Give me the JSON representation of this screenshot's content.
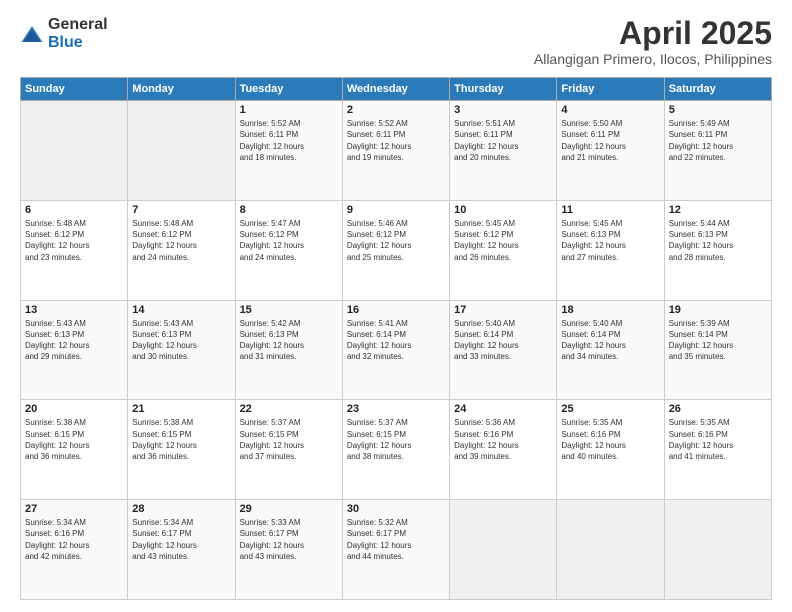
{
  "header": {
    "logo": {
      "general": "General",
      "blue": "Blue"
    },
    "title": "April 2025",
    "location": "Allangigan Primero, Ilocos, Philippines"
  },
  "weekdays": [
    "Sunday",
    "Monday",
    "Tuesday",
    "Wednesday",
    "Thursday",
    "Friday",
    "Saturday"
  ],
  "weeks": [
    [
      {
        "day": "",
        "info": ""
      },
      {
        "day": "",
        "info": ""
      },
      {
        "day": "1",
        "info": "Sunrise: 5:52 AM\nSunset: 6:11 PM\nDaylight: 12 hours\nand 18 minutes."
      },
      {
        "day": "2",
        "info": "Sunrise: 5:52 AM\nSunset: 6:11 PM\nDaylight: 12 hours\nand 19 minutes."
      },
      {
        "day": "3",
        "info": "Sunrise: 5:51 AM\nSunset: 6:11 PM\nDaylight: 12 hours\nand 20 minutes."
      },
      {
        "day": "4",
        "info": "Sunrise: 5:50 AM\nSunset: 6:11 PM\nDaylight: 12 hours\nand 21 minutes."
      },
      {
        "day": "5",
        "info": "Sunrise: 5:49 AM\nSunset: 6:11 PM\nDaylight: 12 hours\nand 22 minutes."
      }
    ],
    [
      {
        "day": "6",
        "info": "Sunrise: 5:48 AM\nSunset: 6:12 PM\nDaylight: 12 hours\nand 23 minutes."
      },
      {
        "day": "7",
        "info": "Sunrise: 5:48 AM\nSunset: 6:12 PM\nDaylight: 12 hours\nand 24 minutes."
      },
      {
        "day": "8",
        "info": "Sunrise: 5:47 AM\nSunset: 6:12 PM\nDaylight: 12 hours\nand 24 minutes."
      },
      {
        "day": "9",
        "info": "Sunrise: 5:46 AM\nSunset: 6:12 PM\nDaylight: 12 hours\nand 25 minutes."
      },
      {
        "day": "10",
        "info": "Sunrise: 5:45 AM\nSunset: 6:12 PM\nDaylight: 12 hours\nand 26 minutes."
      },
      {
        "day": "11",
        "info": "Sunrise: 5:45 AM\nSunset: 6:13 PM\nDaylight: 12 hours\nand 27 minutes."
      },
      {
        "day": "12",
        "info": "Sunrise: 5:44 AM\nSunset: 6:13 PM\nDaylight: 12 hours\nand 28 minutes."
      }
    ],
    [
      {
        "day": "13",
        "info": "Sunrise: 5:43 AM\nSunset: 6:13 PM\nDaylight: 12 hours\nand 29 minutes."
      },
      {
        "day": "14",
        "info": "Sunrise: 5:43 AM\nSunset: 6:13 PM\nDaylight: 12 hours\nand 30 minutes."
      },
      {
        "day": "15",
        "info": "Sunrise: 5:42 AM\nSunset: 6:13 PM\nDaylight: 12 hours\nand 31 minutes."
      },
      {
        "day": "16",
        "info": "Sunrise: 5:41 AM\nSunset: 6:14 PM\nDaylight: 12 hours\nand 32 minutes."
      },
      {
        "day": "17",
        "info": "Sunrise: 5:40 AM\nSunset: 6:14 PM\nDaylight: 12 hours\nand 33 minutes."
      },
      {
        "day": "18",
        "info": "Sunrise: 5:40 AM\nSunset: 6:14 PM\nDaylight: 12 hours\nand 34 minutes."
      },
      {
        "day": "19",
        "info": "Sunrise: 5:39 AM\nSunset: 6:14 PM\nDaylight: 12 hours\nand 35 minutes."
      }
    ],
    [
      {
        "day": "20",
        "info": "Sunrise: 5:38 AM\nSunset: 6:15 PM\nDaylight: 12 hours\nand 36 minutes."
      },
      {
        "day": "21",
        "info": "Sunrise: 5:38 AM\nSunset: 6:15 PM\nDaylight: 12 hours\nand 36 minutes."
      },
      {
        "day": "22",
        "info": "Sunrise: 5:37 AM\nSunset: 6:15 PM\nDaylight: 12 hours\nand 37 minutes."
      },
      {
        "day": "23",
        "info": "Sunrise: 5:37 AM\nSunset: 6:15 PM\nDaylight: 12 hours\nand 38 minutes."
      },
      {
        "day": "24",
        "info": "Sunrise: 5:36 AM\nSunset: 6:16 PM\nDaylight: 12 hours\nand 39 minutes."
      },
      {
        "day": "25",
        "info": "Sunrise: 5:35 AM\nSunset: 6:16 PM\nDaylight: 12 hours\nand 40 minutes."
      },
      {
        "day": "26",
        "info": "Sunrise: 5:35 AM\nSunset: 6:16 PM\nDaylight: 12 hours\nand 41 minutes."
      }
    ],
    [
      {
        "day": "27",
        "info": "Sunrise: 5:34 AM\nSunset: 6:16 PM\nDaylight: 12 hours\nand 42 minutes."
      },
      {
        "day": "28",
        "info": "Sunrise: 5:34 AM\nSunset: 6:17 PM\nDaylight: 12 hours\nand 43 minutes."
      },
      {
        "day": "29",
        "info": "Sunrise: 5:33 AM\nSunset: 6:17 PM\nDaylight: 12 hours\nand 43 minutes."
      },
      {
        "day": "30",
        "info": "Sunrise: 5:32 AM\nSunset: 6:17 PM\nDaylight: 12 hours\nand 44 minutes."
      },
      {
        "day": "",
        "info": ""
      },
      {
        "day": "",
        "info": ""
      },
      {
        "day": "",
        "info": ""
      }
    ]
  ]
}
